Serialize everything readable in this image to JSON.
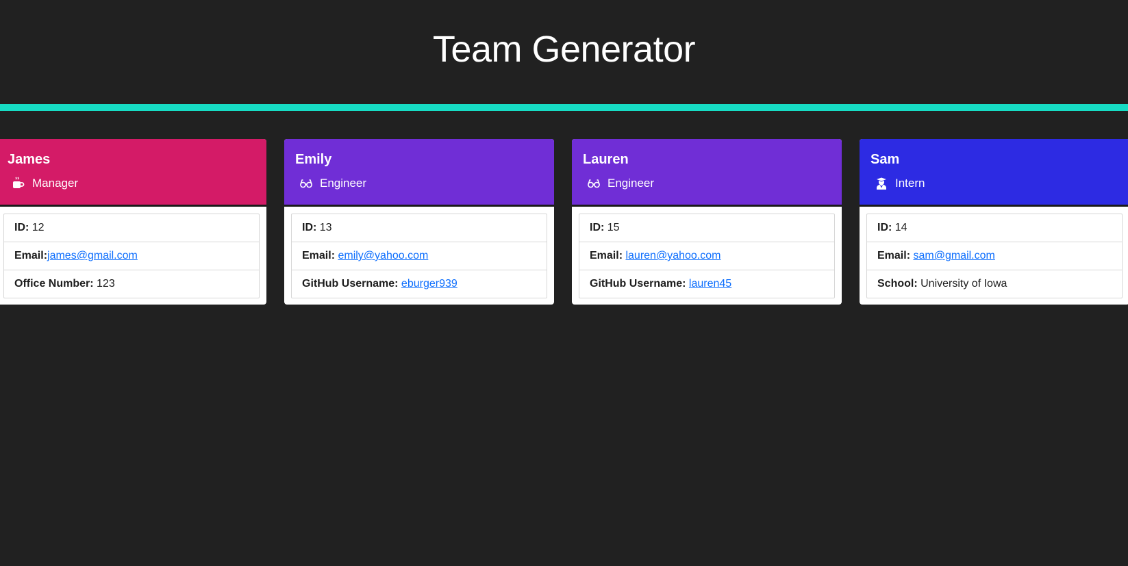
{
  "page": {
    "title": "Team Generator",
    "background": "#212121",
    "accent_color": "#17dcc4"
  },
  "team": [
    {
      "name": "James",
      "role": "Manager",
      "role_icon": "mug-hot-icon",
      "header_color": "#d41b67",
      "id_label": "ID:",
      "id_value": "12",
      "email_label": "Email:",
      "email": "james@gmail.com",
      "extra_label": "Office Number:",
      "extra_value": "123"
    },
    {
      "name": "Emily",
      "role": "Engineer",
      "role_icon": "glasses-icon",
      "header_color": "#702ed6",
      "id_label": "ID:",
      "id_value": "13",
      "email_label": "Email:",
      "email": "emily@yahoo.com",
      "extra_label": "GitHub Username:",
      "extra_value": "eburger939"
    },
    {
      "name": "Lauren",
      "role": "Engineer",
      "role_icon": "glasses-icon",
      "header_color": "#702ed6",
      "id_label": "ID:",
      "id_value": "15",
      "email_label": "Email:",
      "email": "lauren@yahoo.com",
      "extra_label": "GitHub Username:",
      "extra_value": "lauren45"
    },
    {
      "name": "Sam",
      "role": "Intern",
      "role_icon": "user-graduate-icon",
      "header_color": "#2d2be3",
      "id_label": "ID:",
      "id_value": "14",
      "email_label": "Email:",
      "email": "sam@gmail.com",
      "extra_label": "School:",
      "extra_value": "University of Iowa"
    }
  ]
}
